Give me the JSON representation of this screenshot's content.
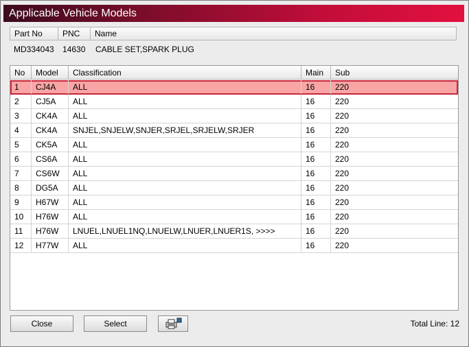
{
  "window": {
    "title": "Applicable Vehicle Models"
  },
  "part": {
    "headers": {
      "part_no": "Part No",
      "pnc": "PNC",
      "name": "Name"
    },
    "part_no": "MD334043",
    "pnc": "14630",
    "name": "CABLE SET,SPARK PLUG"
  },
  "list": {
    "headers": {
      "no": "No",
      "model": "Model",
      "classification": "Classification",
      "main": "Main",
      "sub": "Sub"
    },
    "selected_index": 0,
    "rows": [
      {
        "no": "1",
        "model": "CJ4A",
        "classification": "ALL",
        "main": "16",
        "sub": "220"
      },
      {
        "no": "2",
        "model": "CJ5A",
        "classification": "ALL",
        "main": "16",
        "sub": "220"
      },
      {
        "no": "3",
        "model": "CK4A",
        "classification": "ALL",
        "main": "16",
        "sub": "220"
      },
      {
        "no": "4",
        "model": "CK4A",
        "classification": "SNJEL,SNJELW,SNJER,SRJEL,SRJELW,SRJER",
        "main": "16",
        "sub": "220"
      },
      {
        "no": "5",
        "model": "CK5A",
        "classification": "ALL",
        "main": "16",
        "sub": "220"
      },
      {
        "no": "6",
        "model": "CS6A",
        "classification": "ALL",
        "main": "16",
        "sub": "220"
      },
      {
        "no": "7",
        "model": "CS6W",
        "classification": "ALL",
        "main": "16",
        "sub": "220"
      },
      {
        "no": "8",
        "model": "DG5A",
        "classification": "ALL",
        "main": "16",
        "sub": "220"
      },
      {
        "no": "9",
        "model": "H67W",
        "classification": "ALL",
        "main": "16",
        "sub": "220"
      },
      {
        "no": "10",
        "model": "H76W",
        "classification": "ALL",
        "main": "16",
        "sub": "220"
      },
      {
        "no": "11",
        "model": "H76W",
        "classification": "LNUEL,LNUEL1NQ,LNUELW,LNUER,LNUER1S,  >>>>",
        "main": "16",
        "sub": "220"
      },
      {
        "no": "12",
        "model": "H77W",
        "classification": "ALL",
        "main": "16",
        "sub": "220"
      }
    ]
  },
  "footer": {
    "close_label": "Close",
    "select_label": "Select",
    "print_icon": "printer-icon",
    "total_label": "Total Line: 12"
  },
  "colors": {
    "title_gradient_start": "#3b0a1e",
    "title_gradient_end": "#e2103f",
    "selected_row_bg": "#f9a5a5",
    "selected_row_border": "#c8263a"
  }
}
